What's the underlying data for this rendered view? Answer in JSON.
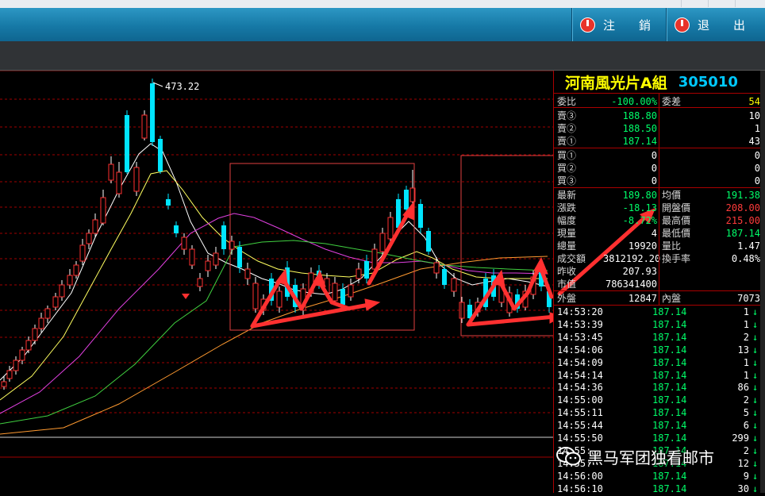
{
  "header": {
    "logout_label": "注　　銷",
    "exit_label": "退　　出"
  },
  "chart": {
    "high_label": "473.22"
  },
  "stock": {
    "name": "河南風光片A組",
    "code": "305010"
  },
  "quote": [
    {
      "l": "委比",
      "v": "-100.00%",
      "vc": "g",
      "l2": "委差",
      "v2": "54",
      "v2c": "y"
    },
    {
      "l": "賣③",
      "v": "188.80",
      "vc": "g",
      "l2": "",
      "v2": "10",
      "v2c": "w"
    },
    {
      "l": "賣②",
      "v": "188.50",
      "vc": "g",
      "l2": "",
      "v2": "1",
      "v2c": "w"
    },
    {
      "l": "賣①",
      "v": "187.14",
      "vc": "g",
      "l2": "",
      "v2": "43",
      "v2c": "w"
    },
    {
      "l": "買①",
      "v": "0",
      "vc": "w",
      "l2": "",
      "v2": "0",
      "v2c": "w"
    },
    {
      "l": "買②",
      "v": "0",
      "vc": "w",
      "l2": "",
      "v2": "0",
      "v2c": "w"
    },
    {
      "l": "買③",
      "v": "0",
      "vc": "w",
      "l2": "",
      "v2": "0",
      "v2c": "w"
    },
    {
      "l": "最新",
      "v": "189.80",
      "vc": "g",
      "l2": "均價",
      "v2": "191.38",
      "v2c": "g"
    },
    {
      "l": "漲跌",
      "v": "-18.13",
      "vc": "g",
      "l2": "開盤價",
      "v2": "208.00",
      "v2c": "r"
    },
    {
      "l": "幅度",
      "v": "-8.72%",
      "vc": "g",
      "l2": "最高價",
      "v2": "215.00",
      "v2c": "r"
    },
    {
      "l": "現量",
      "v": "4",
      "vc": "w",
      "l2": "最低價",
      "v2": "187.14",
      "v2c": "g"
    },
    {
      "l": "總量",
      "v": "19920",
      "vc": "w",
      "l2": "量比",
      "v2": "1.47",
      "v2c": "w"
    },
    {
      "l": "成交額",
      "v": "3812192.20",
      "vc": "w",
      "l2": "換手率",
      "v2": "0.48%",
      "v2c": "w"
    },
    {
      "l": "昨收",
      "v": "207.93",
      "vc": "w",
      "l2": "",
      "v2": "",
      "v2c": "w"
    },
    {
      "l": "市值",
      "v": "786341400",
      "vc": "w",
      "l2": "",
      "v2": "",
      "v2c": "w"
    },
    {
      "l": "外盤",
      "v": "12847",
      "vc": "w",
      "l2": "內盤",
      "v2": "7073",
      "v2c": "w"
    }
  ],
  "ticks": [
    {
      "t": "14:53:20",
      "p": "187.14",
      "q": "1"
    },
    {
      "t": "14:53:39",
      "p": "187.14",
      "q": "1"
    },
    {
      "t": "14:53:45",
      "p": "187.14",
      "q": "2"
    },
    {
      "t": "14:54:06",
      "p": "187.14",
      "q": "13"
    },
    {
      "t": "14:54:09",
      "p": "187.14",
      "q": "1"
    },
    {
      "t": "14:54:14",
      "p": "187.14",
      "q": "1"
    },
    {
      "t": "14:54:36",
      "p": "187.14",
      "q": "86"
    },
    {
      "t": "14:55:00",
      "p": "187.14",
      "q": "2"
    },
    {
      "t": "14:55:11",
      "p": "187.14",
      "q": "5"
    },
    {
      "t": "14:55:44",
      "p": "187.14",
      "q": "6"
    },
    {
      "t": "14:55:50",
      "p": "187.14",
      "q": "299"
    },
    {
      "t": "14:55:",
      "p": "187.14",
      "q": "2"
    },
    {
      "t": "14:55:",
      "p": "187.14",
      "q": "12"
    },
    {
      "t": "14:56:00",
      "p": "187.14",
      "q": "9"
    },
    {
      "t": "14:56:10",
      "p": "187.14",
      "q": "30"
    }
  ],
  "tick_arrow": "↓",
  "watermark": "黑马军团独看邮市"
}
